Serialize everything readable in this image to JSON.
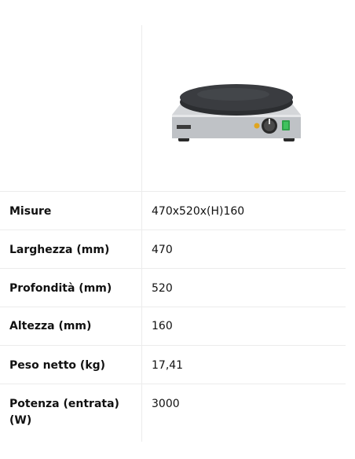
{
  "specs": [
    {
      "label": "Misure",
      "value": "470x520x(H)160"
    },
    {
      "label": "Larghezza (mm)",
      "value": "470"
    },
    {
      "label": "Profondità (mm)",
      "value": "520"
    },
    {
      "label": "Altezza (mm)",
      "value": "160"
    },
    {
      "label": "Peso netto (kg)",
      "value": "17,41"
    },
    {
      "label": "Potenza (entrata) (W)",
      "value": "3000"
    }
  ],
  "product_image": {
    "icon": "crepe-maker-image",
    "colors": {
      "plate": "#3a3c40",
      "body": "#c9cbce",
      "switch": "#2fa14a"
    }
  }
}
